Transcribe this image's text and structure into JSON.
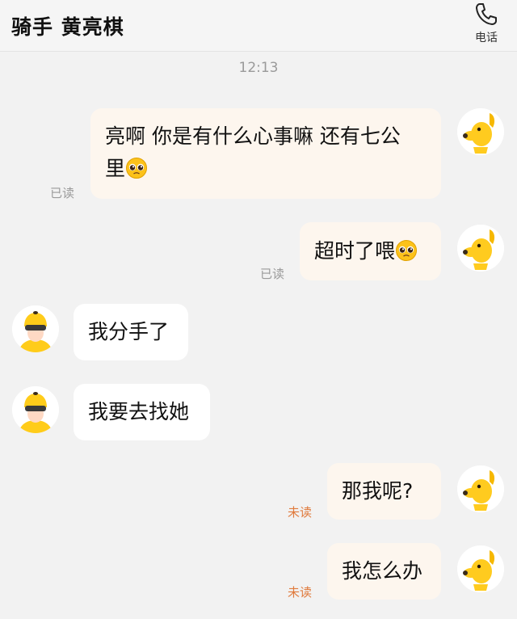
{
  "header": {
    "title": "骑手 黄亮棋",
    "call_label": "电话"
  },
  "timestamp": "12:13",
  "messages": [
    {
      "text": "亮啊 你是有什么心事嘛 还有七公",
      "text2": "里",
      "status": "已读"
    },
    {
      "text": "超时了喂",
      "status": "已读"
    },
    {
      "text": "我分手了"
    },
    {
      "text": "我要去找她"
    },
    {
      "text": "那我呢?",
      "status": "未读"
    },
    {
      "text": "我怎么办",
      "status": "未读"
    }
  ],
  "colors": {
    "outgoing_bubble": "#fdf6ee",
    "incoming_bubble": "#ffffff",
    "unread_status": "#e07a3c",
    "read_status": "#9a9a9a"
  },
  "icons": {
    "call": "phone-icon",
    "my_avatar": "yellow-dog-avatar",
    "rider_avatar": "rider-helmet-avatar",
    "emoji": "pleading-face-emoji"
  }
}
